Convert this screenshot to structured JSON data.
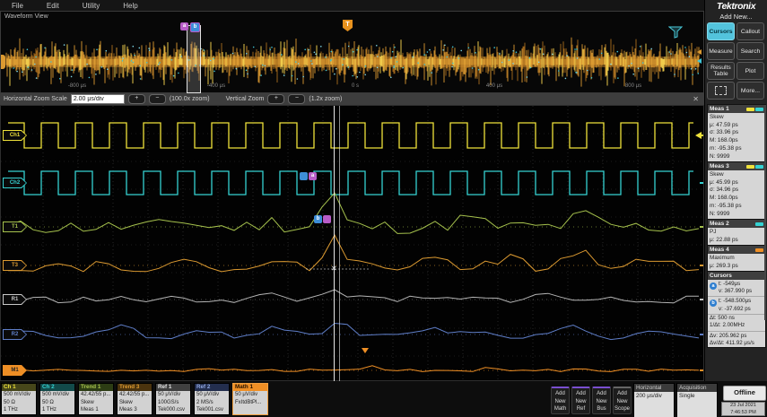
{
  "menu": {
    "items": [
      "File",
      "Edit",
      "Utility",
      "Help"
    ]
  },
  "overview": {
    "title": "Waveform View",
    "ticks": [
      "-800 μs",
      "-400 μs",
      "0 s",
      "400 μs",
      "800 μs"
    ],
    "cursor_a": "a",
    "cursor_b": "b",
    "trigger_label": "T"
  },
  "zoombar": {
    "h_label": "Horizontal Zoom Scale",
    "h_value": "2.00 μs/div",
    "plus": "+",
    "minus": "−",
    "h_zoom": "(100.0x zoom)",
    "v_label": "Vertical Zoom",
    "v_zoom": "(1.2x zoom)",
    "close": "✕"
  },
  "main": {
    "channels": [
      {
        "label": "Ch1"
      },
      {
        "label": "Ch2"
      },
      {
        "label": "T1"
      },
      {
        "label": "T3"
      },
      {
        "label": "R1"
      },
      {
        "label": "R2"
      },
      {
        "label": "M1"
      }
    ],
    "cursor_a": "a",
    "cursor_b": "b"
  },
  "colors": {
    "yellow": "#efe23b",
    "cyan": "#35d2d2",
    "green": "#a6c24d",
    "orange": "#dc9a31",
    "gray": "#c8c8c8",
    "blue": "#5f7ec8",
    "math": "#ef8f25",
    "purple": "#b85cc8",
    "handle_blue": "#3e8ed8",
    "noise_hi": "#f2cf4e",
    "noise_mid": "#dc9a31",
    "noise_lo": "#b3741f",
    "speckle": "#3fc6d8"
  },
  "sidebar": {
    "brand": "Tektronix",
    "add_new": "Add New...",
    "buttons": [
      "Cursors",
      "Callout",
      "Measure",
      "Search",
      "Results Table",
      "Plot",
      "",
      "More..."
    ],
    "meas": [
      {
        "title": "Meas 1",
        "lines": [
          "Skew",
          "μ: 47.59 ps",
          "σ: 33.96 ps",
          "M: 168.0ps",
          "m: -95.38 ps",
          "N: 9999"
        ]
      },
      {
        "title": "Meas 3",
        "lines": [
          "Skew",
          "μ: 45.99 ps",
          "σ: 34.96 ps",
          "M: 168.0ps",
          "m: -95.38 ps",
          "N: 9999"
        ]
      },
      {
        "title": "Meas 2",
        "lines": [
          "PJ",
          "μ: 22.88 ps"
        ]
      },
      {
        "title": "Meas 4",
        "lines": [
          "Maximum",
          "μ: 269.3 ps"
        ]
      }
    ],
    "cursors": {
      "title": "Cursors",
      "a_label": "a",
      "a_t": "t: -549μs",
      "a_v": "v: 367.990 ps",
      "b_label": "b",
      "b_t": "t: -548.500μs",
      "b_v": "v: -37.692 ps",
      "d1": "Δt: 500 ns",
      "d2": "1/Δt: 2.00MHz",
      "d3": "Δv: 205.962 ps",
      "d4": "Δv/Δt: 411.92 μs/s"
    }
  },
  "bottombar": {
    "badges": [
      {
        "title": "Ch 1",
        "l1": "500 mV/div",
        "l2": "50 Ω",
        "l3": "1 THz"
      },
      {
        "title": "Ch 2",
        "l1": "500 mV/div",
        "l2": "50 Ω",
        "l3": "1 THz"
      },
      {
        "title": "Trend 1",
        "l1": "42.42/55 p...",
        "l2": "Skew",
        "l3": "Meas 1"
      },
      {
        "title": "Trend 3",
        "l1": "42.42/55 p...",
        "l2": "Skew",
        "l3": "Meas 3"
      },
      {
        "title": "Ref 1",
        "l1": "50 μV/div",
        "l2": "100GS/s",
        "l3": "Tek000.csv"
      },
      {
        "title": "Ref 2",
        "l1": "50 μV/div",
        "l2": "2 MS/s",
        "l3": "Tek001.csv"
      },
      {
        "title": "Math 1",
        "l1": "50 μV/div",
        "l2": "FxItdBtPl...",
        "l3": ""
      }
    ],
    "add_buttons": [
      {
        "l1": "Add",
        "l2": "New",
        "l3": "Math"
      },
      {
        "l1": "Add",
        "l2": "New",
        "l3": "Ref"
      },
      {
        "l1": "Add",
        "l2": "New",
        "l3": "Bus"
      },
      {
        "l1": "Add",
        "l2": "New",
        "l3": "Scope"
      }
    ],
    "horizontal": {
      "title": "Horizontal",
      "value": "200 μs/div"
    },
    "acquisition": {
      "title": "Acquisition",
      "value": "Single"
    },
    "offline": "Offline",
    "date": "23 Jul 2021",
    "time": "7:46:53 PM"
  }
}
